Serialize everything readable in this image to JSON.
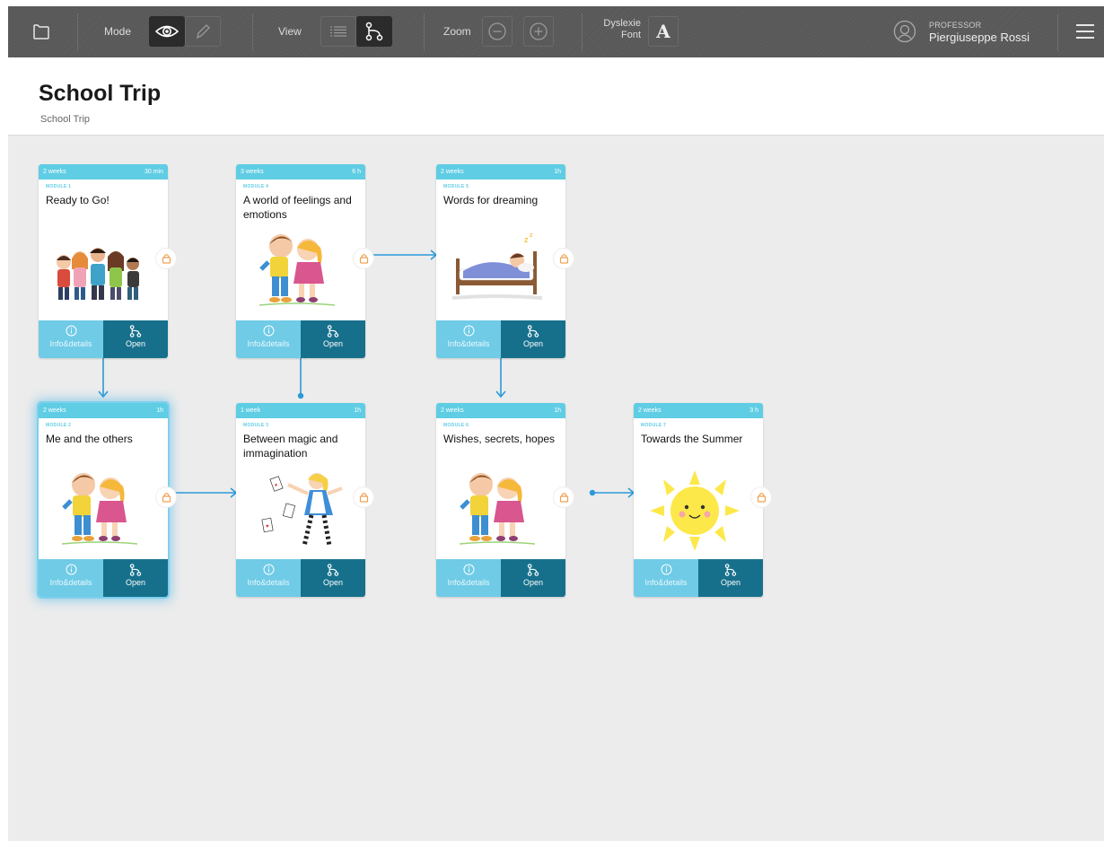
{
  "toolbar": {
    "mode_label": "Mode",
    "view_label": "View",
    "zoom_label": "Zoom",
    "dyslexia_line1": "Dyslexie",
    "dyslexia_line2": "Font",
    "dyslexia_button": "A",
    "profile_role": "PROFESSOR",
    "profile_name": "Piergiuseppe Rossi",
    "active_mode": "view",
    "active_view": "map",
    "icons": [
      "folder-icon",
      "eye-icon",
      "pencil-icon",
      "list-icon",
      "map-icon",
      "zoom-out-icon",
      "zoom-in-icon",
      "user-icon",
      "menu-icon"
    ]
  },
  "header": {
    "title": "School Trip",
    "breadcrumb": "School Trip"
  },
  "cards": [
    {
      "duration": "2 weeks",
      "time": "30 min",
      "module": "MODULE 1",
      "title": "Ready to Go!",
      "info": "Info&details",
      "open": "Open",
      "illustration": "children-group"
    },
    {
      "duration": "3 weeks",
      "time": "6 h",
      "module": "MODULE 4",
      "title": "A world of feelings and emotions",
      "info": "Info&details",
      "open": "Open",
      "illustration": "kids-kiss"
    },
    {
      "duration": "2 weeks",
      "time": "1h",
      "module": "MODULE 5",
      "title": "Words for dreaming",
      "info": "Info&details",
      "open": "Open",
      "illustration": "sleeping-child"
    },
    {
      "duration": "2 weeks",
      "time": "1h",
      "module": "MODULE 2",
      "title": "Me and the others",
      "info": "Info&details",
      "open": "Open",
      "illustration": "kids-kiss",
      "selected": true
    },
    {
      "duration": "1 week",
      "time": "1h",
      "module": "MODULE 3",
      "title": "Between magic and immagination",
      "info": "Info&details",
      "open": "Open",
      "illustration": "alice"
    },
    {
      "duration": "2 weeks",
      "time": "1h",
      "module": "MODULE 6",
      "title": "Wishes, secrets, hopes",
      "info": "Info&details",
      "open": "Open",
      "illustration": "kids-kiss"
    },
    {
      "duration": "2 weeks",
      "time": "3 h",
      "module": "MODULE 7",
      "title": "Towards the Summer",
      "info": "Info&details",
      "open": "Open",
      "illustration": "sun"
    }
  ],
  "colors": {
    "toolbar_bg": "#5a5a5a",
    "card_header": "#5fcde4",
    "info_bg": "#6fcbe6",
    "open_bg": "#16708c",
    "connector": "#2a9ad8",
    "lock": "#f0a050",
    "board_bg": "#ececec"
  }
}
